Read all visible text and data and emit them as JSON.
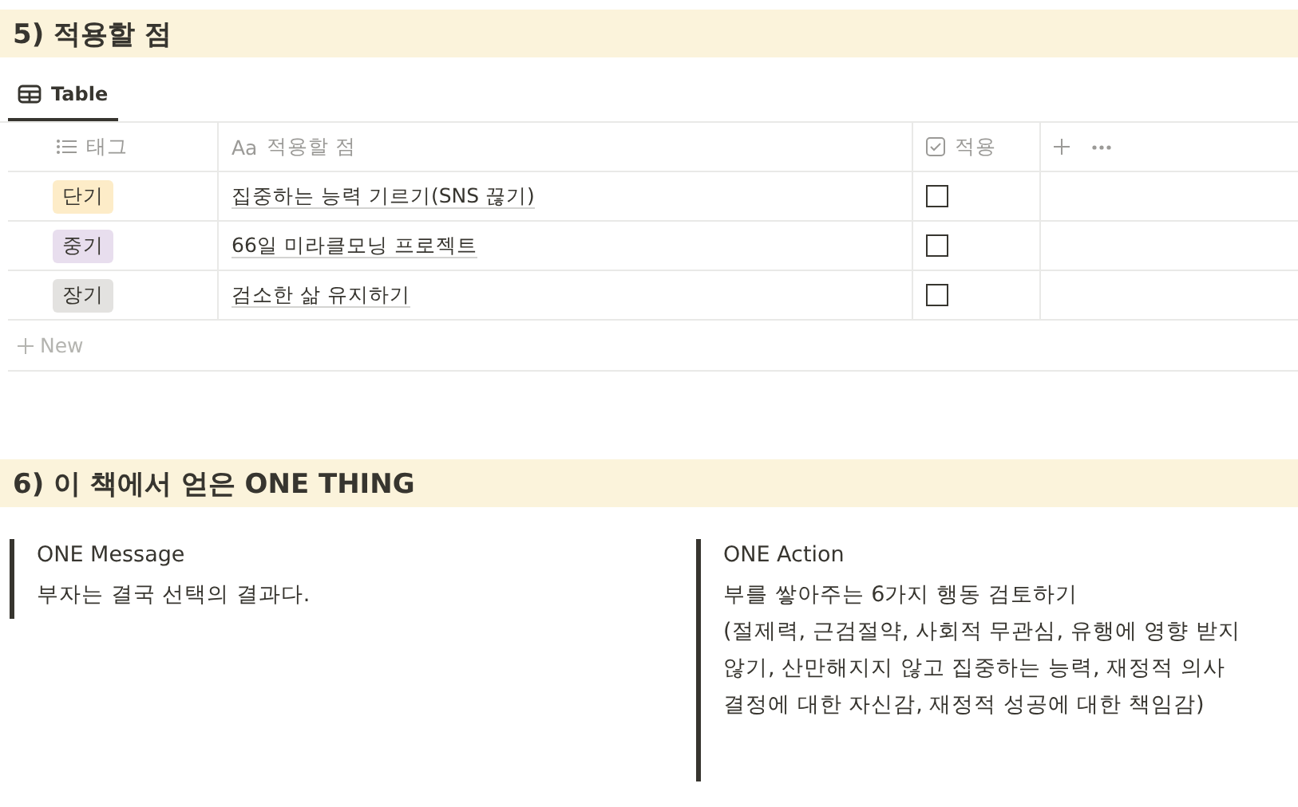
{
  "sections": [
    {
      "title": "5) 적용할 점"
    },
    {
      "title": "6) 이 책에서 얻은 ONE THING"
    }
  ],
  "view_tab": {
    "label": "Table",
    "selected": true
  },
  "table": {
    "columns": [
      {
        "label": "태그",
        "kind": "list"
      },
      {
        "label": "적용할 점",
        "kind": "title",
        "icon_text": "Aa"
      },
      {
        "label": "적용",
        "kind": "checkbox"
      }
    ],
    "rows": [
      {
        "tag": {
          "label": "단기",
          "color": "#fdecc8"
        },
        "title": "집중하는 능력 기르기(SNS 끊기)",
        "checked": false
      },
      {
        "tag": {
          "label": "중기",
          "color": "#e8deee"
        },
        "title": "66일 미라클모닝 프로젝트",
        "checked": false
      },
      {
        "tag": {
          "label": "장기",
          "color": "#e3e2e0"
        },
        "title": "검소한 삶 유지하기",
        "checked": false
      }
    ],
    "new_row": "New"
  },
  "quotes": [
    {
      "heading": "ONE Message",
      "lines": [
        "부자는 결국 선택의 결과다."
      ]
    },
    {
      "heading": "ONE Action",
      "lines": [
        "부를 쌓아주는 6가지 행동 검토하기",
        "(절제력, 근검절약, 사회적 무관심, 유행에 영향 받지 않기, 산만해지지 않고 집중하는 능력, 재정적 의사 결정에 대한 자신감, 재정적 성공에 대한 책임감)"
      ]
    }
  ]
}
